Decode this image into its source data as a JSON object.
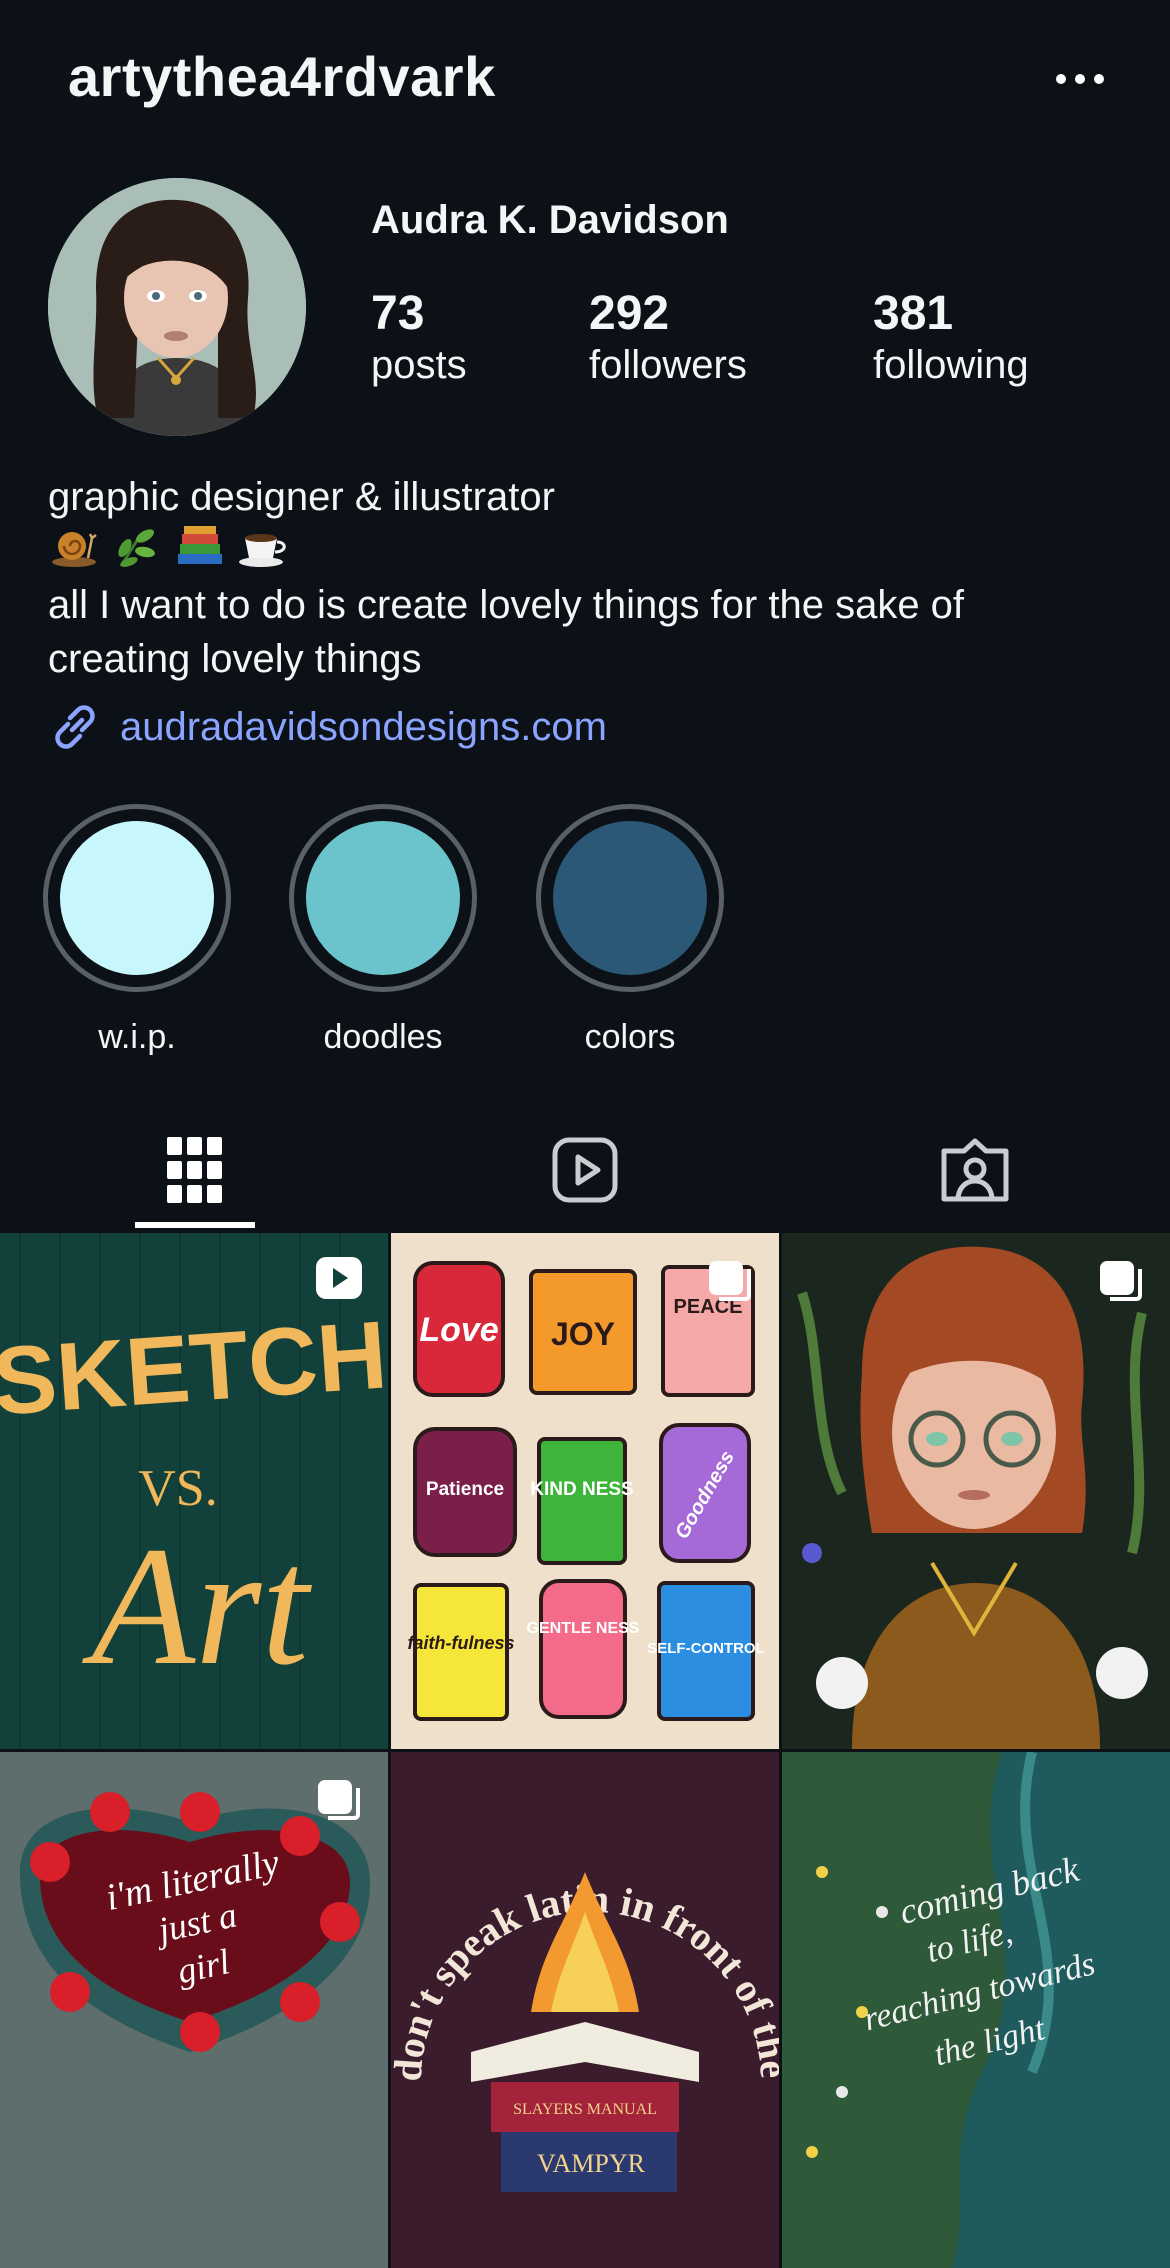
{
  "header": {
    "username": "artythea4rdvark"
  },
  "profile": {
    "display_name": "Audra K. Davidson",
    "stats": [
      {
        "value": "73",
        "label": "posts"
      },
      {
        "value": "292",
        "label": "followers"
      },
      {
        "value": "381",
        "label": "following"
      }
    ],
    "bio": {
      "line1": "graphic designer & illustrator",
      "emojis": [
        "snail-icon",
        "herb-icon",
        "books-icon",
        "coffee-icon"
      ],
      "line2": "all I want to do is create lovely things for the sake of",
      "line3": "creating lovely things"
    },
    "link": "audradavidsondesigns.com"
  },
  "highlights": [
    {
      "label": "w.i.p.",
      "color": "#c7f7fd"
    },
    {
      "label": "doodles",
      "color": "#6bc3cb"
    },
    {
      "label": "colors",
      "color": "#2a5876"
    }
  ],
  "tabs": [
    "grid-icon",
    "reels-icon",
    "tagged-icon"
  ],
  "posts": [
    {
      "kind": "reel",
      "text": [
        "SKETCH",
        "VS.",
        "Art"
      ]
    },
    {
      "kind": "carousel",
      "text": [
        "Love",
        "JOY",
        "PEACE",
        "Patience",
        "KIND NESS",
        "Goodness",
        "faith-fulness",
        "GENTLE NESS",
        "SELF-CONTROL"
      ]
    },
    {
      "kind": "carousel",
      "text": []
    },
    {
      "kind": "carousel",
      "text": [
        "i'm literally",
        "just a",
        "girl"
      ]
    },
    {
      "kind": "none",
      "text": [
        "don't speak latin in front of the bo",
        "SLAYERS MANUAL",
        "VAMPYR"
      ]
    },
    {
      "kind": "none",
      "text": [
        "coming back",
        "to life,",
        "reaching towards",
        "the light"
      ]
    }
  ]
}
